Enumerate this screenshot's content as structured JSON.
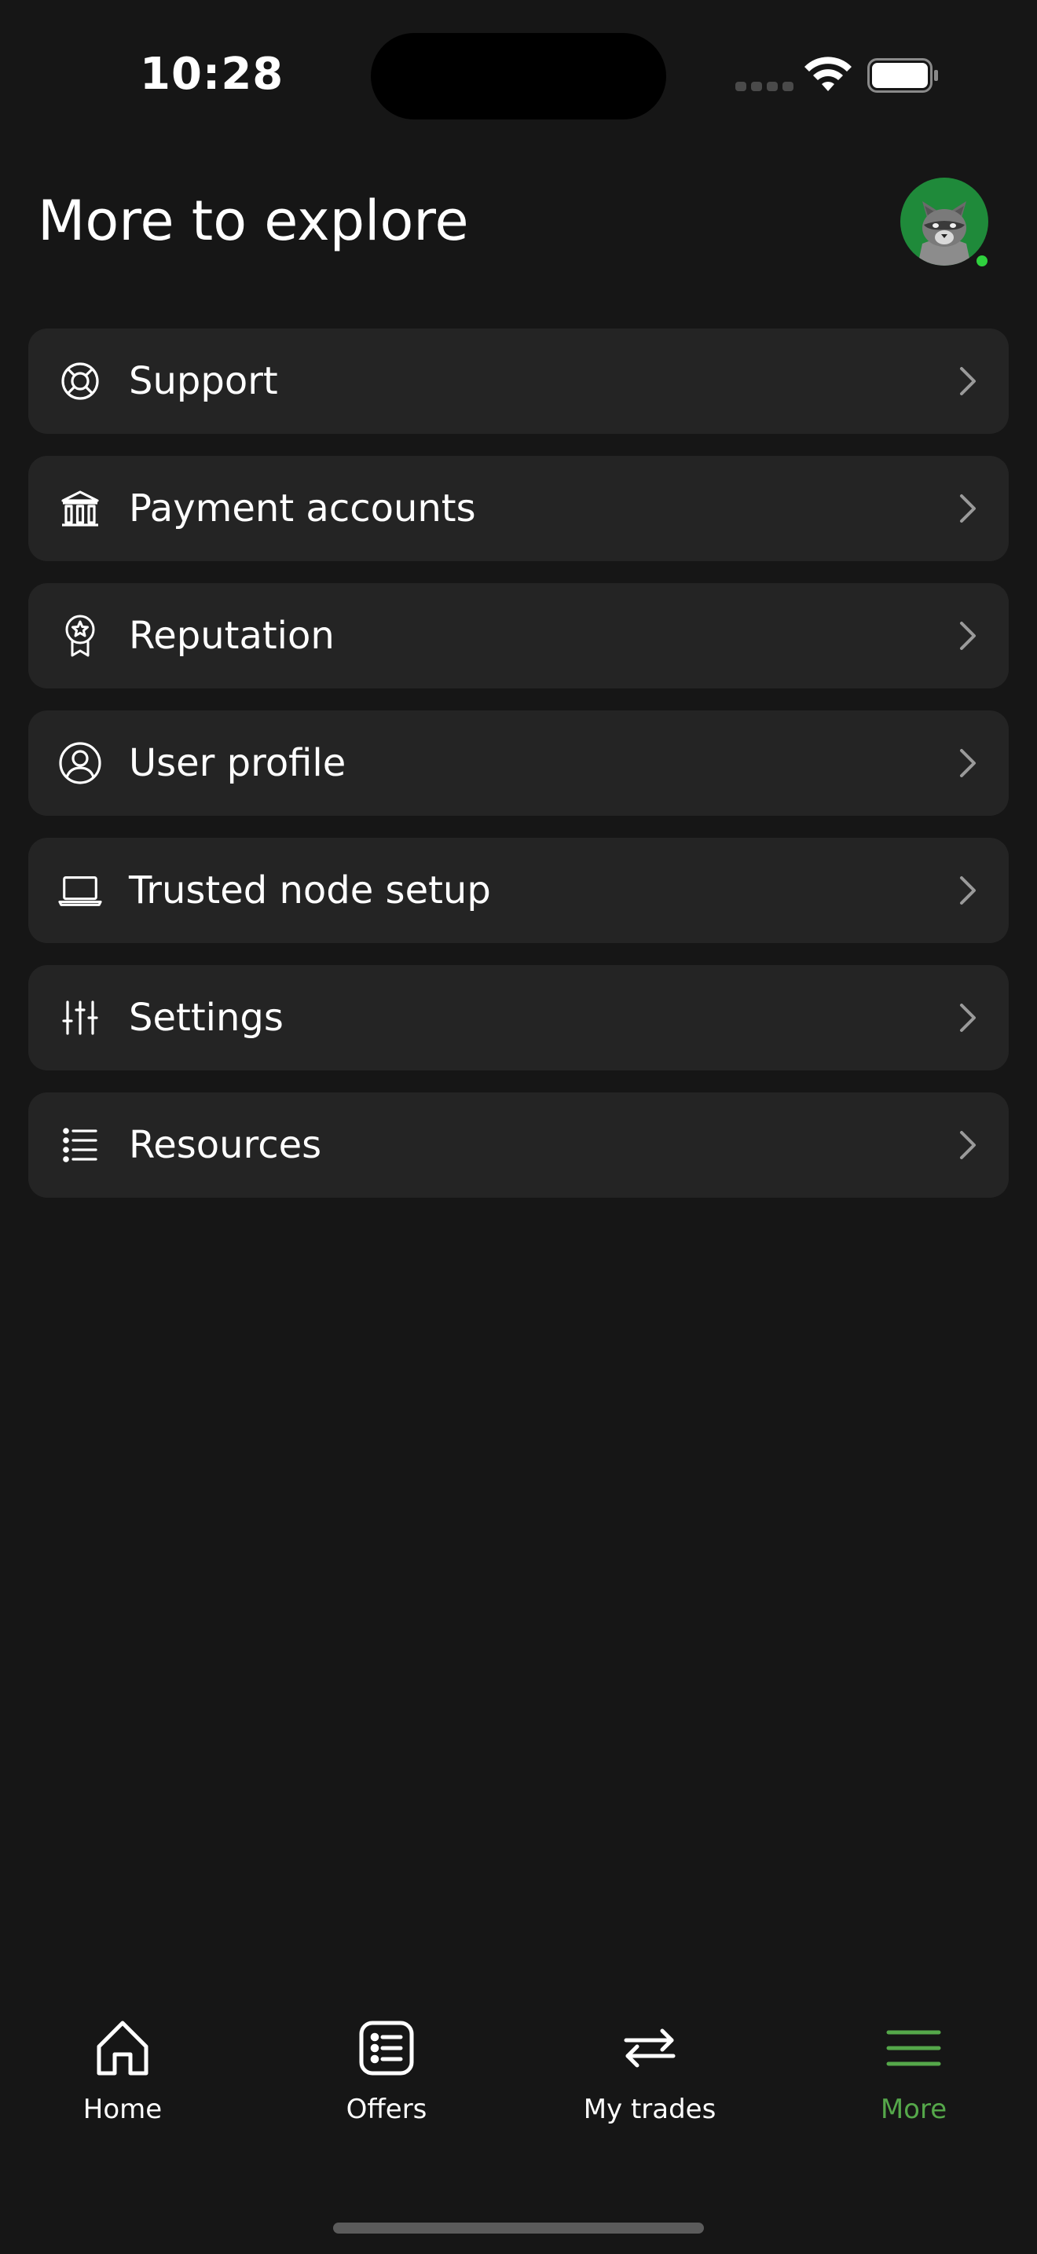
{
  "status_bar": {
    "time": "10:28"
  },
  "header": {
    "title": "More to explore"
  },
  "menu": {
    "items": [
      {
        "label": "Support",
        "icon": "lifebuoy-icon"
      },
      {
        "label": "Payment accounts",
        "icon": "bank-icon"
      },
      {
        "label": "Reputation",
        "icon": "award-icon"
      },
      {
        "label": "User profile",
        "icon": "user-circle-icon"
      },
      {
        "label": "Trusted node setup",
        "icon": "laptop-icon"
      },
      {
        "label": "Settings",
        "icon": "sliders-icon"
      },
      {
        "label": "Resources",
        "icon": "list-icon"
      }
    ]
  },
  "bottom_nav": {
    "items": [
      {
        "label": "Home",
        "icon": "home-icon"
      },
      {
        "label": "Offers",
        "icon": "offers-icon"
      },
      {
        "label": "My trades",
        "icon": "swap-arrows-icon"
      },
      {
        "label": "More",
        "icon": "menu-icon",
        "active": true
      }
    ]
  },
  "colors": {
    "background": "#161616",
    "card": "#242424",
    "accent": "#55a84a",
    "avatar_bg": "#1f8a3a",
    "online_dot": "#2fd13e"
  }
}
